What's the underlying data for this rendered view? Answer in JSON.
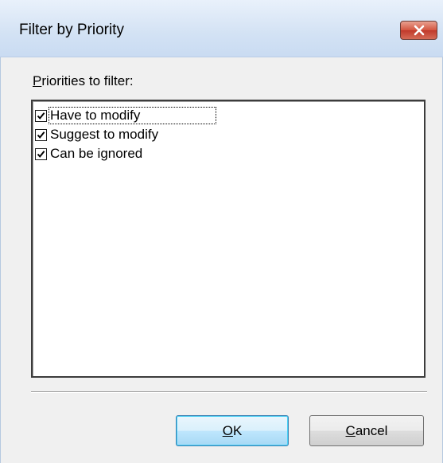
{
  "window": {
    "title": "Filter by Priority"
  },
  "group": {
    "label_mnemonic": "P",
    "label_rest": "riorities to filter:"
  },
  "priorities": [
    {
      "label": "Have to modify",
      "checked": true,
      "focused": true
    },
    {
      "label": "Suggest to modify",
      "checked": true,
      "focused": false
    },
    {
      "label": "Can be ignored",
      "checked": true,
      "focused": false
    }
  ],
  "buttons": {
    "ok_mnemonic": "O",
    "ok_rest": "K",
    "cancel_mnemonic": "C",
    "cancel_rest": "ancel"
  },
  "icons": {
    "close": "close-icon",
    "check": "checkmark-icon"
  },
  "colors": {
    "close_button": "#c9402c",
    "title_bar": "#d3e2f4",
    "default_button_border": "#3c7fb1"
  }
}
